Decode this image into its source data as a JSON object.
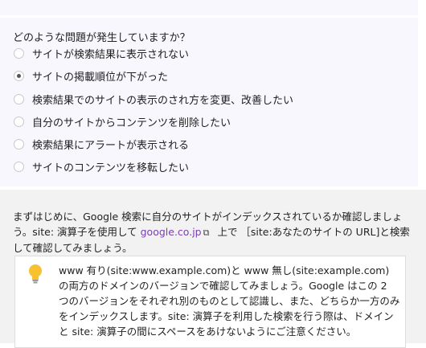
{
  "question": {
    "label": "どのような問題が発生していますか？",
    "options": [
      {
        "label": "サイトが検索結果に表示されない",
        "selected": false
      },
      {
        "label": "サイトの掲載順位が下がった",
        "selected": true
      },
      {
        "label": "検索結果でのサイトの表示のされ方を変更、改善したい",
        "selected": false
      },
      {
        "label": "自分のサイトからコンテンツを削除したい",
        "selected": false
      },
      {
        "label": "検索結果にアラートが表示される",
        "selected": false
      },
      {
        "label": "サイトのコンテンツを移転したい",
        "selected": false
      }
    ]
  },
  "intro": {
    "text_before": "まずはじめに、Google 検索に自分のサイトがインデックスされているか確認しましょう。site: 演算子を使用して ",
    "link": "google.co.jp",
    "link_icon": "external-link-icon",
    "text_after": " 上で ［site:あなたのサイトの URL]と検索して確認してみましょう。"
  },
  "tip": {
    "icon": "lightbulb-icon",
    "text": "www 有り(site:www.example.com)と www 無し(site:example.com) の両方のドメインのバージョンで確認してみましょう。Google はこの 2 つのバージョンをそれぞれ別のものとして認識し、また、どちらか一方のみをインデックスします。site: 演算子を利用した検索を行う際は、ドメインと site: 演算子の間にスペースをあけないようにご注意ください。"
  }
}
